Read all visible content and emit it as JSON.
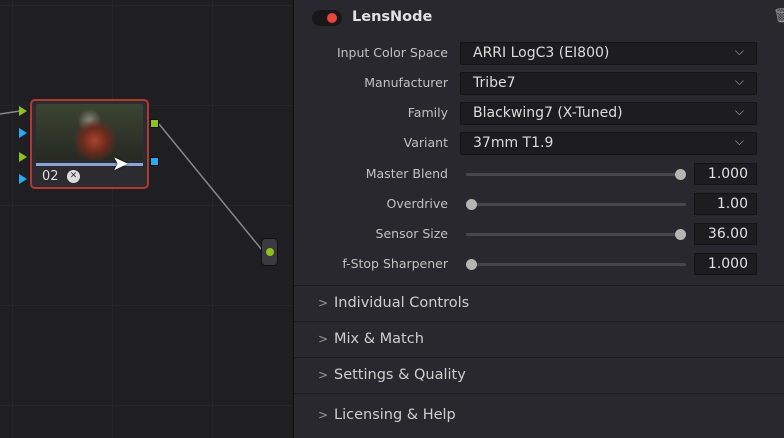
{
  "node_editor": {
    "node_label": "02",
    "colors": {
      "green": "#8cc21a",
      "blue": "#2aa8f0",
      "border": "#b03a32"
    }
  },
  "panel": {
    "title": "LensNode",
    "dropdowns": [
      {
        "label": "Input Color Space",
        "value": "ARRI LogC3 (EI800)"
      },
      {
        "label": "Manufacturer",
        "value": "Tribe7"
      },
      {
        "label": "Family",
        "value": "Blackwing7 (X-Tuned)"
      },
      {
        "label": "Variant",
        "value": "37mm T1.9"
      }
    ],
    "sliders": [
      {
        "label": "Master Blend",
        "value": "1.000",
        "fraction": 1.0
      },
      {
        "label": "Overdrive",
        "value": "1.00",
        "fraction": 0.0
      },
      {
        "label": "Sensor Size",
        "value": "36.00",
        "fraction": 1.0
      },
      {
        "label": "f-Stop Sharpener",
        "value": "1.000",
        "fraction": 0.0
      }
    ],
    "sections": [
      "Individual Controls",
      "Mix & Match",
      "Settings & Quality",
      "Licensing & Help"
    ]
  }
}
